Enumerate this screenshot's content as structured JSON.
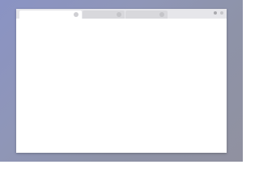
{
  "desktop": {
    "background_colors": [
      "#8a93c4",
      "#9091a0"
    ]
  },
  "window": {
    "tabs": [
      {
        "label": "",
        "active": true,
        "close_icon": "close-icon"
      },
      {
        "label": "",
        "active": false,
        "close_icon": "close-icon"
      },
      {
        "label": "",
        "active": false,
        "close_icon": "close-icon"
      }
    ],
    "controls": [
      "minimize-icon",
      "close-icon"
    ],
    "content_color": "#ffffff",
    "titlebar_color": "#e6e6ea"
  }
}
